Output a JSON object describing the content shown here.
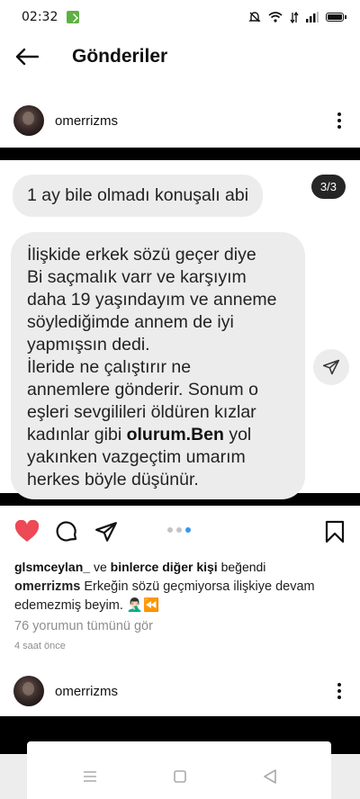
{
  "status_bar": {
    "time": "02:32",
    "icons": [
      "app-notification-icon",
      "mute-icon",
      "wifi-icon",
      "data-icon",
      "signal-icon",
      "battery-icon"
    ]
  },
  "top_bar": {
    "back_icon": "arrow-left-icon",
    "title": "Gönderiler"
  },
  "post": {
    "username": "omerrizms",
    "page_indicator": "3/3",
    "message_1": "1 ay bile olmadı konuşalı abi",
    "message_2_lines": [
      "İlişkide erkek sözü geçer diye",
      "Bi saçmalık varr ve karşıyım",
      "daha 19 yaşındayım ve anneme",
      "söylediğimde annem de iyi",
      "yapmışsın dedi.",
      "İleride ne çalıştırır ne",
      "annemlere gönderir. Sonum o",
      "eşleri sevgilileri öldüren kızlar",
      "kadınlar gibi "
    ],
    "message_2_bold": "olurum.Ben",
    "message_2_after_bold": " yol",
    "message_2_tail_lines": [
      "yakınken vazgeçtim umarım",
      "herkes böyle düşünür."
    ],
    "carousel": {
      "count": 3,
      "active_index": 2
    },
    "likes": {
      "first_user": "glsmceylan_",
      "connector": " ve ",
      "others": "binlerce diğer kişi",
      "suffix": " beğendi"
    },
    "caption": {
      "username": "omerrizms",
      "text": " Erkeğin sözü geçmiyorsa ilişkiye devam edemezmiş beyim. 🤦🏻‍♂️⏪"
    },
    "comments_link": "76 yorumun tümünü gör",
    "time_ago": "4 saat önce"
  },
  "next_post": {
    "username": "omerrizms"
  },
  "colors": {
    "like_red": "#ed4956",
    "bubble_gray": "#ececec",
    "carousel_active": "#3897f0",
    "muted_text": "#8e8e8e"
  }
}
